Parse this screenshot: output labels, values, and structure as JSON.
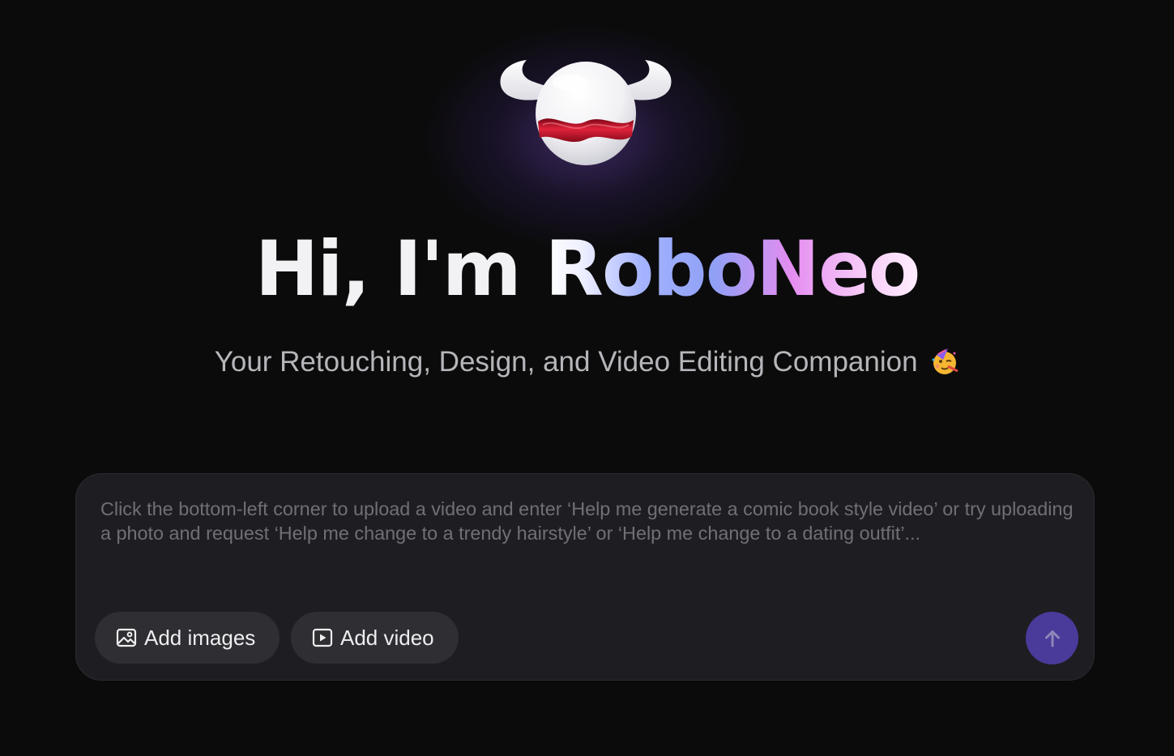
{
  "hero": {
    "greeting": "Hi, I'm ",
    "brand": "RoboNeo",
    "subtitle": "Your Retouching, Design, and Video Editing Companion",
    "subtitle_emoji_icon": "party-face-icon",
    "mascot_icon": "roboneo-mascot-icon"
  },
  "composer": {
    "placeholder": "Click the bottom-left corner to upload a video and enter ‘Help me generate a comic book style video’ or try uploading a photo and request ‘Help me change to a trendy hairstyle’ or ‘Help me change to a dating outfit’...",
    "value": "",
    "add_images_label": "Add images",
    "add_images_icon": "image-icon",
    "add_video_label": "Add video",
    "add_video_icon": "video-icon",
    "send_icon": "arrow-up-icon"
  },
  "colors": {
    "background": "#0b0b0c",
    "composer_bg": "#1e1e22",
    "chip_bg": "#2e2e33",
    "send_bg": "#4a3a9a",
    "accent_red": "#c8102e",
    "glow": "#8c5ae6"
  }
}
